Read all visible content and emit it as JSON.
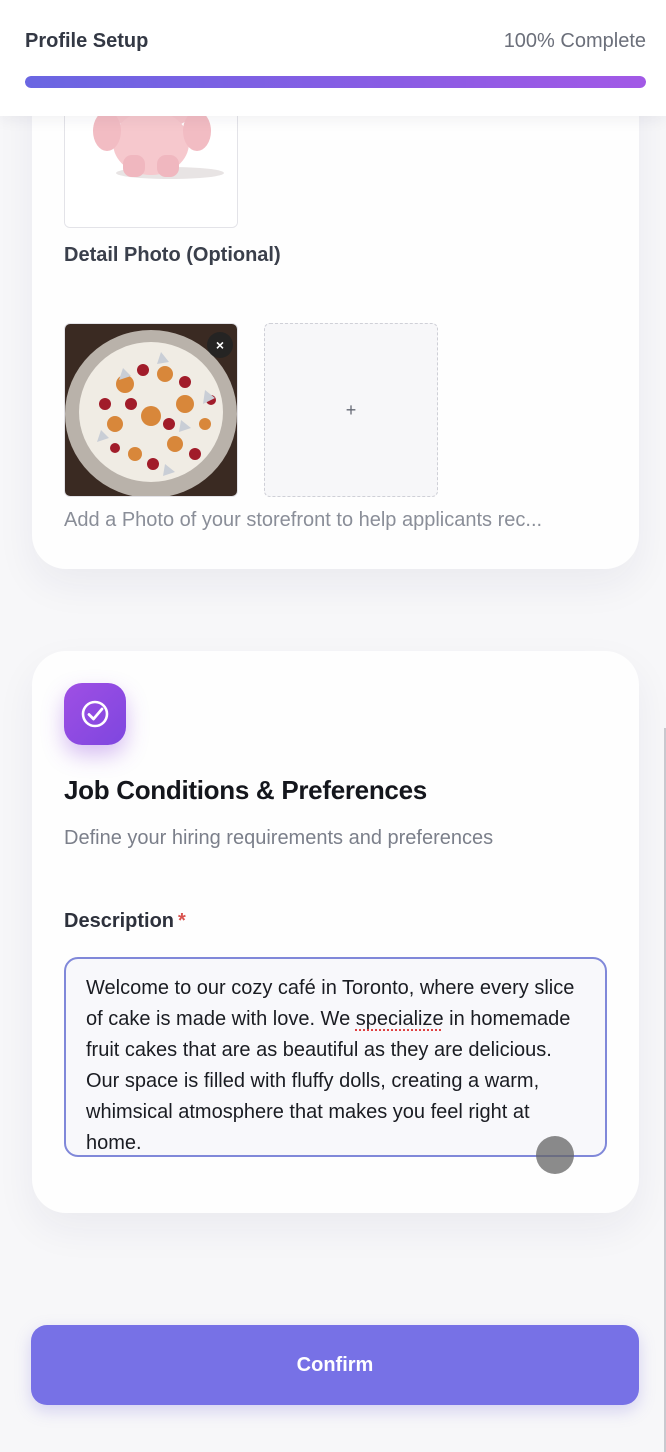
{
  "header": {
    "title": "Profile Setup",
    "progress_label": "100% Complete",
    "progress_fraction": 1.0
  },
  "photos": {
    "main_image": "pink-pig-doll",
    "detail_label": "Detail Photo (Optional)",
    "detail_image": "fruit-cake",
    "remove_icon": "×",
    "add_icon": "+",
    "hint": "Add a Photo of your storefront to help applicants rec..."
  },
  "job": {
    "icon": "check-circle-icon",
    "title": "Job Conditions & Preferences",
    "subtitle": "Define your hiring requirements and preferences",
    "description_label": "Description",
    "required_mark": "*",
    "description_text_before": "Welcome to our cozy café in Toronto, where every slice of cake is made with love. We ",
    "description_misspelled": "specialize",
    "description_text_after": " in homemade fruit cakes that are as beautiful as they are delicious. Our space is filled with fluffy dolls, creating a warm, whimsical atmosphere that makes you feel right at home."
  },
  "actions": {
    "confirm_label": "Confirm"
  },
  "colors": {
    "accent": "#7771e6",
    "progress_start": "#6a66e2",
    "progress_end": "#a259e6",
    "icon_gradient": "#9f4fe4",
    "required": "#d9534f"
  }
}
